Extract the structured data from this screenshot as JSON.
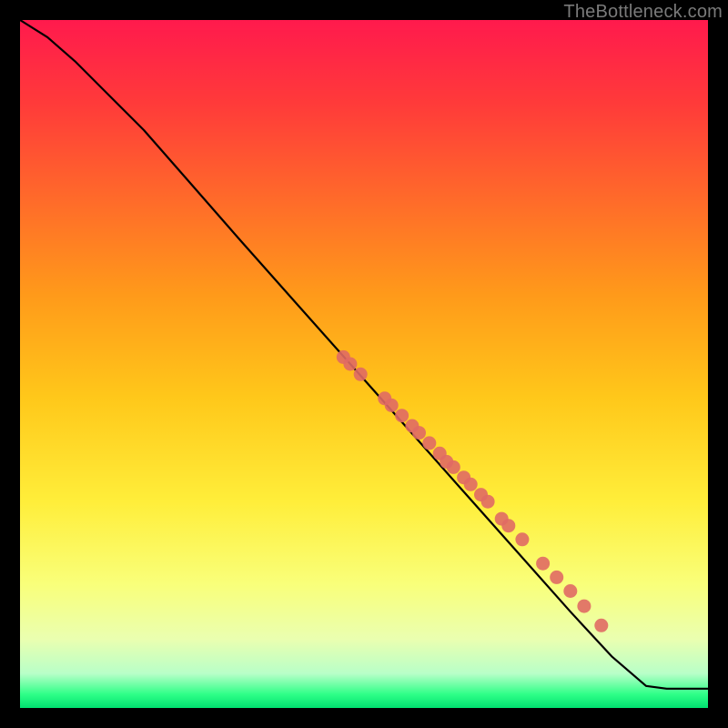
{
  "watermark": "TheBottleneck.com",
  "colors": {
    "gradient_top": "#ff1a4d",
    "gradient_bottom": "#00e070",
    "line": "#000000",
    "point_fill": "#e06a64",
    "point_stroke": "#b84e48",
    "frame_bg": "#000000"
  },
  "chart_data": {
    "type": "line",
    "title": "",
    "xlabel": "",
    "ylabel": "",
    "xlim": [
      0,
      100
    ],
    "ylim": [
      0,
      100
    ],
    "grid": false,
    "legend": false,
    "series": [
      {
        "name": "curve",
        "x": [
          0,
          4,
          8,
          12,
          18,
          25,
          32,
          40,
          48,
          56,
          64,
          72,
          80,
          86,
          91,
          94,
          100
        ],
        "y": [
          100,
          97.5,
          94,
          90,
          84,
          76,
          68,
          59,
          50,
          41,
          32,
          23,
          14,
          7.5,
          3.2,
          2.8,
          2.8
        ]
      }
    ],
    "points": {
      "name": "highlighted-points",
      "x": [
        47,
        48,
        49.5,
        53,
        54,
        55.5,
        57,
        58,
        59.5,
        61,
        62,
        63,
        64.5,
        65.5,
        67,
        68,
        70,
        71,
        73,
        76,
        78,
        80,
        82,
        84.5
      ],
      "y": [
        51,
        50,
        48.5,
        45,
        44,
        42.5,
        41,
        40,
        38.5,
        37,
        35.8,
        35,
        33.5,
        32.5,
        31,
        30,
        27.5,
        26.5,
        24.5,
        21,
        19,
        17,
        14.8,
        12
      ]
    }
  }
}
